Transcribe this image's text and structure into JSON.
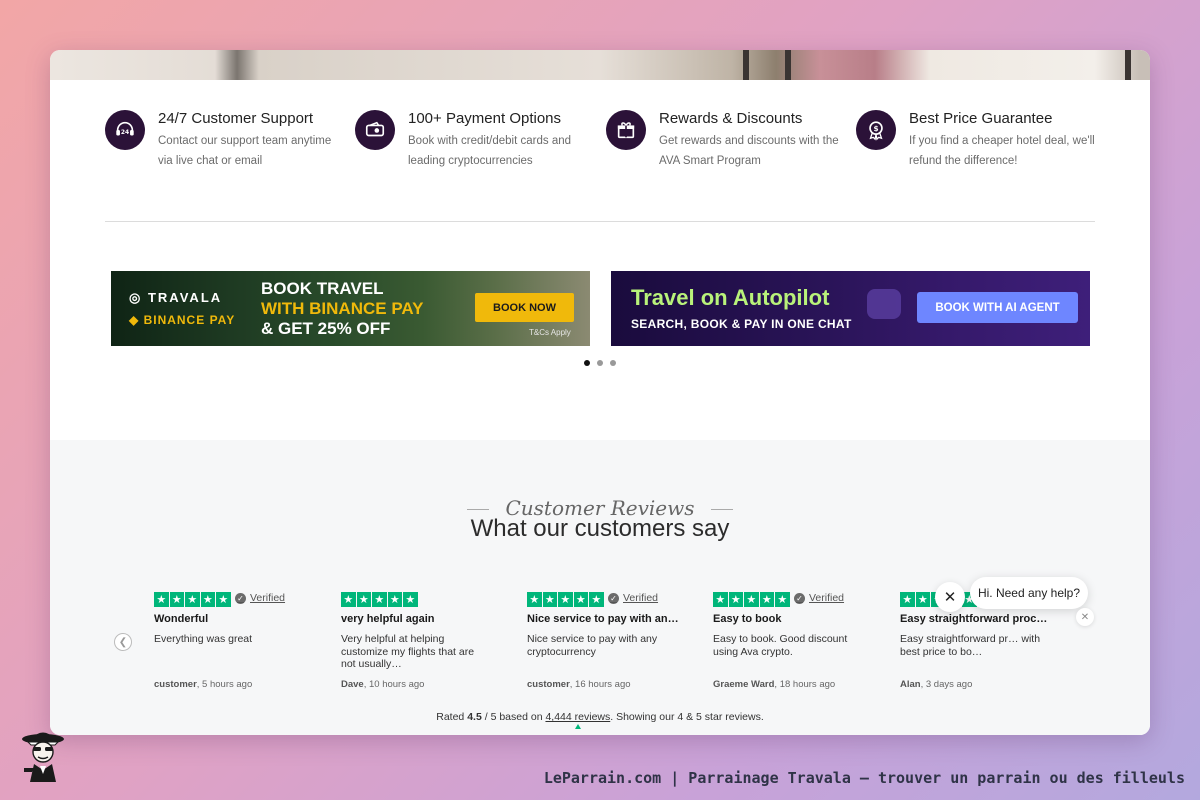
{
  "features": [
    {
      "icon": "headset-24-icon",
      "title": "24/7 Customer Support",
      "desc": "Contact our support team anytime via live chat or email"
    },
    {
      "icon": "wallet-icon",
      "title": "100+ Payment Options",
      "desc": "Book with credit/debit cards and leading cryptocurrencies"
    },
    {
      "icon": "gift-icon",
      "title": "Rewards & Discounts",
      "desc": "Get rewards and discounts with the AVA Smart Program"
    },
    {
      "icon": "price-badge-icon",
      "title": "Best Price Guarantee",
      "desc": "If you find a cheaper hotel deal, we'll refund the difference!"
    }
  ],
  "banners": {
    "binance": {
      "logo_travala": "TRAVALA",
      "logo_binance": "BINANCE PAY",
      "headline_1": "BOOK TRAVEL",
      "headline_2": "WITH BINANCE PAY",
      "headline_3": "& GET 25% OFF",
      "button": "BOOK NOW",
      "terms": "T&Cs Apply"
    },
    "autopilot": {
      "title": "Travel on Autopilot",
      "subtitle": "SEARCH, BOOK & PAY IN ONE CHAT",
      "button": "BOOK WITH AI AGENT"
    }
  },
  "carousel": {
    "active_index": 0,
    "count": 3
  },
  "reviews": {
    "kicker": "Customer Reviews",
    "heading": "What our customers say",
    "verified_label": "Verified",
    "items": [
      {
        "title": "Wonderful",
        "text": "Everything was great",
        "author": "customer",
        "time": "5 hours ago",
        "stars": 5
      },
      {
        "title": "very helpful again",
        "text": "Very helpful at helping customize my flights that are not usually…",
        "author": "Dave",
        "time": "10 hours ago",
        "stars": 5
      },
      {
        "title": "Nice service to pay with an…",
        "text": "Nice service to pay with any cryptocurrency",
        "author": "customer",
        "time": "16 hours ago",
        "stars": 5
      },
      {
        "title": "Easy to book",
        "text": "Easy to book. Good discount using Ava crypto.",
        "author": "Graeme Ward",
        "time": "18 hours ago",
        "stars": 5
      },
      {
        "title": "Easy straightforward proc…",
        "text": "Easy straightforward pr… with best price to bo…",
        "author": "Alan",
        "time": "3 days ago",
        "stars": 5
      }
    ],
    "summary_prefix": "Rated",
    "rating": "4.5",
    "summary_mid": "/ 5 based on",
    "review_count": "4,444 reviews",
    "summary_suffix": ". Showing our 4 & 5 star reviews."
  },
  "chat": {
    "message": "Hi. Need any help?"
  },
  "footer": {
    "caption": "LeParrain.com | Parrainage Travala — trouver un parrain ou des filleuls"
  },
  "colors": {
    "icon_bg": "#2b1238",
    "trustpilot_green": "#00b67a",
    "binance_yellow": "#f0b90b",
    "ai_button": "#6e86ff"
  }
}
